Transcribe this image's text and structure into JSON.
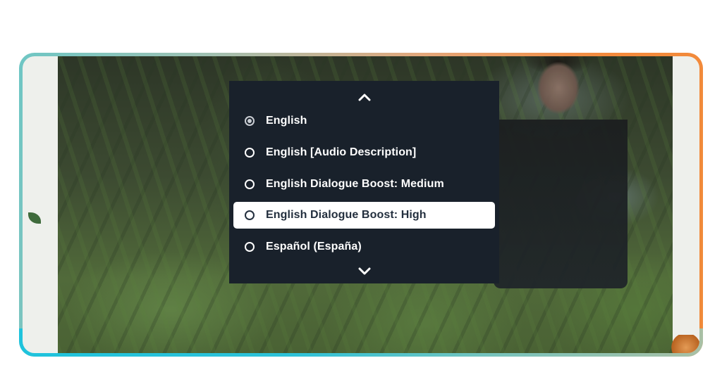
{
  "audio_menu": {
    "scroll_up_icon": "chevron-up-icon",
    "scroll_down_icon": "chevron-down-icon",
    "options": [
      {
        "label": "English",
        "checked": true,
        "focused": false
      },
      {
        "label": "English [Audio Description]",
        "checked": false,
        "focused": false
      },
      {
        "label": "English Dialogue Boost: Medium",
        "checked": false,
        "focused": false
      },
      {
        "label": "English Dialogue Boost: High",
        "checked": false,
        "focused": true
      },
      {
        "label": "Español (España)",
        "checked": false,
        "focused": false
      }
    ]
  },
  "colors": {
    "menu_background": "#19212b",
    "focus_background": "#ffffff",
    "focus_text": "#232f3e",
    "frame_gradient_start": "#1fc3dc",
    "frame_gradient_end": "#f48a3c"
  }
}
